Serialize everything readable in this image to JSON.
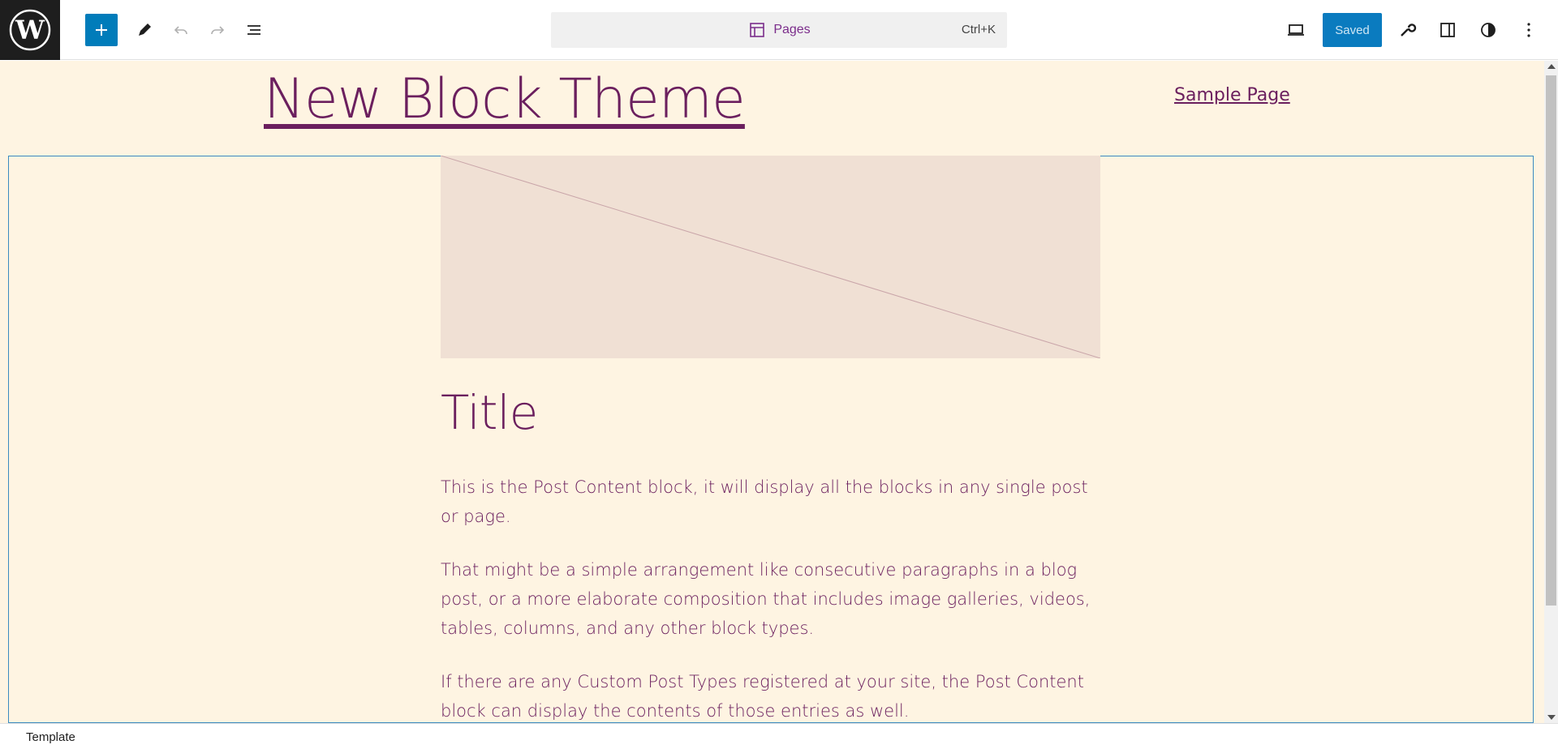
{
  "toolbar": {
    "command_label": "Pages",
    "command_shortcut": "Ctrl+K",
    "saved_label": "Saved"
  },
  "site": {
    "title": "New Block Theme",
    "nav": [
      {
        "label": "Sample Page"
      }
    ]
  },
  "post": {
    "title": "Title",
    "paragraphs": [
      "This is the Post Content block, it will display all the blocks in any single post or page.",
      "That might be a simple arrangement like consecutive paragraphs in a blog post, or a more elaborate composition that includes image galleries, videos, tables, columns, and any other block types.",
      "If there are any Custom Post Types registered at your site, the Post Content block can display the contents of those entries as well."
    ]
  },
  "footer": {
    "breadcrumb": "Template"
  },
  "colors": {
    "accent": "#007cba",
    "text": "#6b1f5e",
    "canvas_bg": "#fef4e2",
    "featured_bg": "#f0e0d4"
  }
}
